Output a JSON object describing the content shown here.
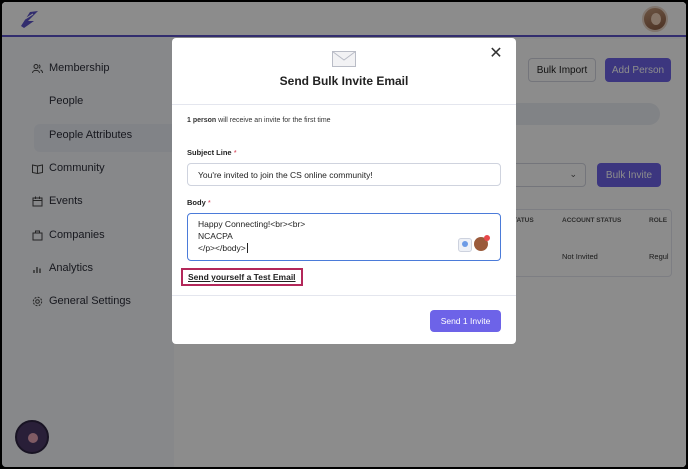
{
  "sidebar": {
    "items": [
      {
        "label": "Membership",
        "icon": "users-icon"
      },
      {
        "label": "People",
        "icon": ""
      },
      {
        "label": "People Attributes",
        "icon": ""
      },
      {
        "label": "Community",
        "icon": "book-icon"
      },
      {
        "label": "Events",
        "icon": "calendar-icon"
      },
      {
        "label": "Companies",
        "icon": "building-icon"
      },
      {
        "label": "Analytics",
        "icon": "bar-chart-icon"
      },
      {
        "label": "General Settings",
        "icon": "gear-icon"
      }
    ]
  },
  "main": {
    "bulk_import_label": "Bulk Import",
    "add_person_label": "Add Person",
    "bulk_invite_label": "Bulk Invite",
    "table": {
      "headers": [
        "TATUS",
        "ACCOUNT STATUS",
        "ROLE"
      ],
      "row": [
        "Not Invited",
        "Regul"
      ]
    }
  },
  "modal": {
    "title": "Send Bulk Invite Email",
    "notice_bold": "1 person",
    "notice_rest": " will receive an invite for the first time",
    "subject_label": "Subject Line",
    "subject_value": "You're invited to join the CS online community!",
    "body_label": "Body",
    "required_mark": "*",
    "body_lines": [
      "Happy Connecting!<br><br>",
      "NCACPA",
      "</p></body>"
    ],
    "test_email_link": "Send yourself a Test Email",
    "send_button": "Send 1 Invite",
    "close_glyph": "✕"
  },
  "colors": {
    "brand": "#5b52c8",
    "primary_button": "#6d63e8",
    "highlight_border": "#b3285a",
    "focus_border": "#4b7bd9"
  }
}
